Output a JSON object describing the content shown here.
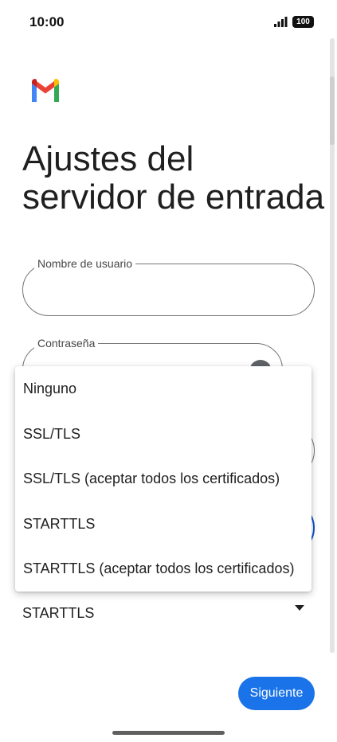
{
  "status_bar": {
    "time": "10:00",
    "battery": "100",
    "icons": [
      "signal-icon",
      "battery-icon"
    ]
  },
  "app": {
    "logo": "gmail-logo",
    "title": "Ajustes del servidor de entrada"
  },
  "form": {
    "username_label": "Nombre de usuario",
    "username_value": "",
    "password_label": "Contraseña",
    "password_value": "",
    "security_type_value": "STARTTLS"
  },
  "dropdown": {
    "options": [
      "Ninguno",
      "SSL/TLS",
      "SSL/TLS (aceptar todos los certificados)",
      "STARTTLS",
      "STARTTLS (aceptar todos los certificados)"
    ]
  },
  "footer": {
    "next_label": "Siguiente"
  },
  "colors": {
    "accent": "#1a73e8",
    "outline": "#747775",
    "text": "#1f1f1f"
  }
}
